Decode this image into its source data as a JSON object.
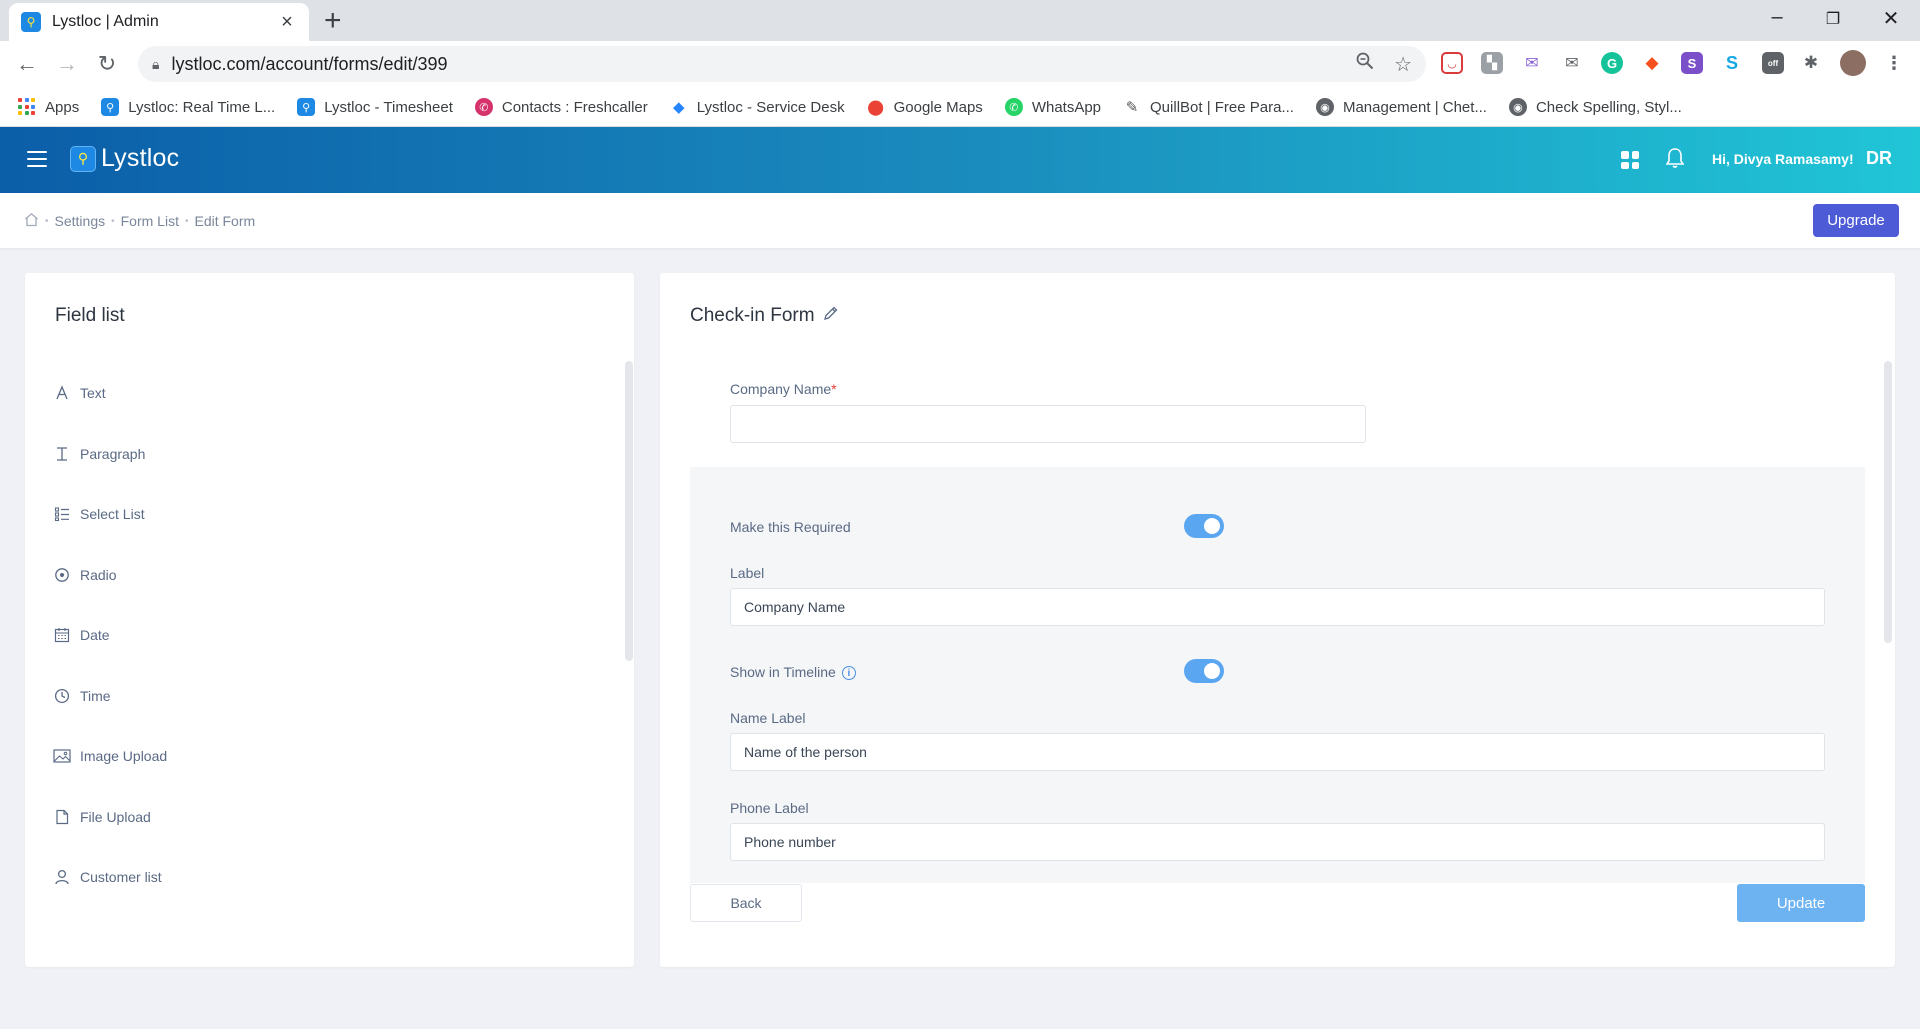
{
  "browser": {
    "tab_title": "Lystloc | Admin",
    "url": "lystloc.com/account/forms/edit/399",
    "bookmarks": [
      {
        "label": "Apps",
        "icon": "apps-grid-icon",
        "color": "#4285f4"
      },
      {
        "label": "Lystloc: Real Time L...",
        "icon": "lystloc-icon",
        "color": "#1e88e5"
      },
      {
        "label": "Lystloc - Timesheet",
        "icon": "lystloc-icon",
        "color": "#1e88e5"
      },
      {
        "label": "Contacts : Freshcaller",
        "icon": "phone-icon",
        "color": "#d6336c"
      },
      {
        "label": "Lystloc - Service Desk",
        "icon": "diamond-icon",
        "color": "#2684ff"
      },
      {
        "label": "Google Maps",
        "icon": "map-pin-icon",
        "color": "#ea4335"
      },
      {
        "label": "WhatsApp",
        "icon": "whatsapp-icon",
        "color": "#25d366"
      },
      {
        "label": "QuillBot | Free Para...",
        "icon": "quill-icon",
        "color": "#555555"
      },
      {
        "label": "Management | Chet...",
        "icon": "globe-icon",
        "color": "#5f6368"
      },
      {
        "label": "Check Spelling, Styl...",
        "icon": "globe-icon",
        "color": "#5f6368"
      }
    ]
  },
  "header": {
    "brand": "Lystloc",
    "greeting": "Hi,  Divya Ramasamy!",
    "initials": "DR"
  },
  "breadcrumb": {
    "items": [
      "Settings",
      "Form List",
      "Edit Form"
    ],
    "upgrade_label": "Upgrade"
  },
  "field_list": {
    "title": "Field list",
    "items": [
      {
        "label": "Text",
        "icon": "text-icon"
      },
      {
        "label": "Paragraph",
        "icon": "paragraph-icon"
      },
      {
        "label": "Select List",
        "icon": "list-icon"
      },
      {
        "label": "Radio",
        "icon": "radio-icon"
      },
      {
        "label": "Date",
        "icon": "calendar-icon"
      },
      {
        "label": "Time",
        "icon": "clock-icon"
      },
      {
        "label": "Image Upload",
        "icon": "image-icon"
      },
      {
        "label": "File Upload",
        "icon": "file-icon"
      },
      {
        "label": "Customer list",
        "icon": "user-icon"
      }
    ]
  },
  "form": {
    "title": "Check-in Form",
    "company_name_label": "Company Name",
    "required_mark": "*",
    "company_name_value": "",
    "make_required_label": "Make this Required",
    "make_required_on": true,
    "label_label": "Label",
    "label_value": "Company Name",
    "show_timeline_label": "Show in Timeline",
    "show_timeline_on": true,
    "name_label_label": "Name Label",
    "name_label_value": "Name of the person",
    "phone_label_label": "Phone Label",
    "phone_label_value": "Phone number",
    "back_label": "Back",
    "update_label": "Update"
  },
  "colors": {
    "header_start": "#0b5ea8",
    "header_end": "#20c5d6",
    "upgrade": "#4e5bd6",
    "toggle_on": "#5aa6f0",
    "update": "#6db3f2"
  }
}
